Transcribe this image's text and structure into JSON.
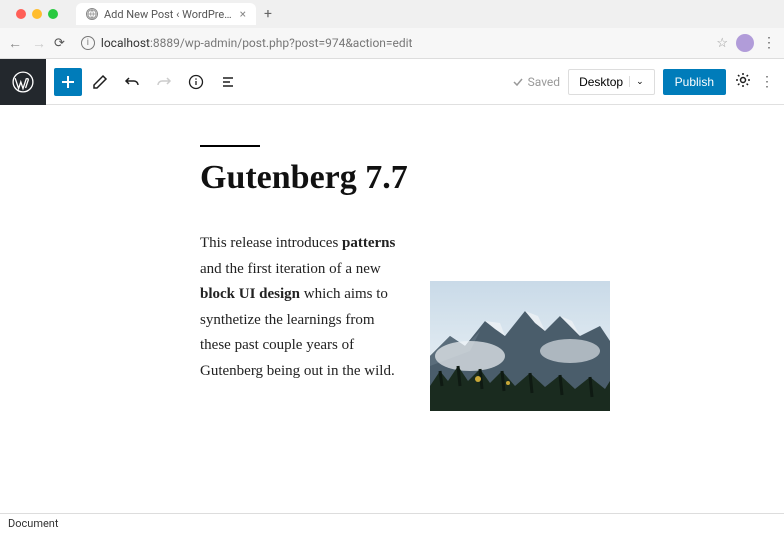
{
  "browser": {
    "tab_title": "Add New Post ‹ WordPress D…",
    "url_host": "localhost",
    "url_path": ":8889/wp-admin/post.php?post=974&action=edit"
  },
  "toolbar": {
    "saved_label": "Saved",
    "preview_label": "Desktop",
    "publish_label": "Publish"
  },
  "post": {
    "title": "Gutenberg 7.7",
    "paragraph_parts": {
      "p1": "This release introduces ",
      "b1": "patterns",
      "p2": " and the first iteration of a new ",
      "b2": "block UI design",
      "p3": " which aims to synthetize the learnings from these past couple years of Gutenberg being out in the wild."
    }
  },
  "footer": {
    "breadcrumb": "Document"
  }
}
